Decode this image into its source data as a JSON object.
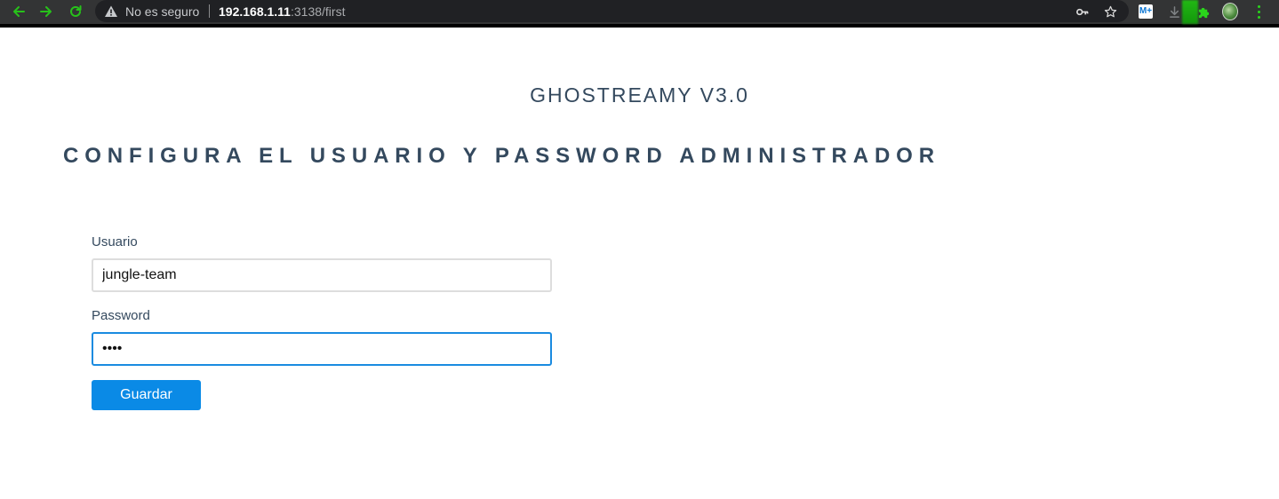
{
  "browser": {
    "security_text": "No es seguro",
    "url_host": "192.168.1.11",
    "url_path": ":3138/first",
    "extension_badge": "M+"
  },
  "app": {
    "title": "GHOSTREAMY V3.0",
    "heading": "CONFIGURA EL USUARIO Y PASSWORD ADMINISTRADOR"
  },
  "form": {
    "username_label": "Usuario",
    "username_value": "jungle-team",
    "password_label": "Password",
    "password_value": "••••",
    "submit_label": "Guardar"
  },
  "colors": {
    "heading": "#34495e",
    "button": "#0a8ae6",
    "focus_border": "#1a8be0"
  }
}
